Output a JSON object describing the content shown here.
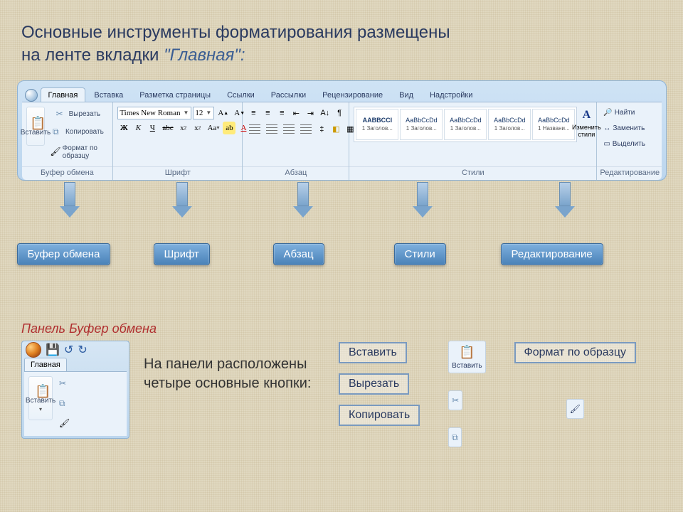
{
  "intro": {
    "line1": "Основные инструменты форматирования размещены",
    "line2_plain": "на ленте вкладки ",
    "line2_quoted": "\"Главная\":"
  },
  "tabs": [
    "Главная",
    "Вставка",
    "Разметка страницы",
    "Ссылки",
    "Рассылки",
    "Рецензирование",
    "Вид",
    "Надстройки"
  ],
  "groups": {
    "clipboard": {
      "label": "Буфер обмена",
      "paste": "Вставить",
      "cut": "Вырезать",
      "copy": "Копировать",
      "format": "Формат по образцу"
    },
    "font": {
      "label": "Шрифт",
      "name": "Times New Roman",
      "size": "12"
    },
    "paragraph": {
      "label": "Абзац"
    },
    "styles": {
      "label": "Стили",
      "change": "Изменить стили",
      "items": [
        {
          "sample": "AABBCCI",
          "name": "1 Заголов..."
        },
        {
          "sample": "AaBbCcDd",
          "name": "1 Заголов..."
        },
        {
          "sample": "AaBbCcDd",
          "name": "1 Заголов..."
        },
        {
          "sample": "AaBbCcDd",
          "name": "1 Заголов..."
        },
        {
          "sample": "AaBbCcDd",
          "name": "1 Названи..."
        }
      ]
    },
    "editing": {
      "label": "Редактирование",
      "find": "Найти",
      "replace": "Заменить",
      "select": "Выделить"
    }
  },
  "arrows": [
    "Буфер обмена",
    "Шрифт",
    "Абзац",
    "Стили",
    "Редактирование"
  ],
  "panel_title": "Панель Буфер обмена",
  "mini_tab": "Главная",
  "mini_paste": "Вставить",
  "body_text": "На панели расположены четыре основные кнопки:",
  "lower_buttons": {
    "paste": "Вставить",
    "cut": "Вырезать",
    "copy": "Копировать",
    "format": "Формат по образцу"
  }
}
